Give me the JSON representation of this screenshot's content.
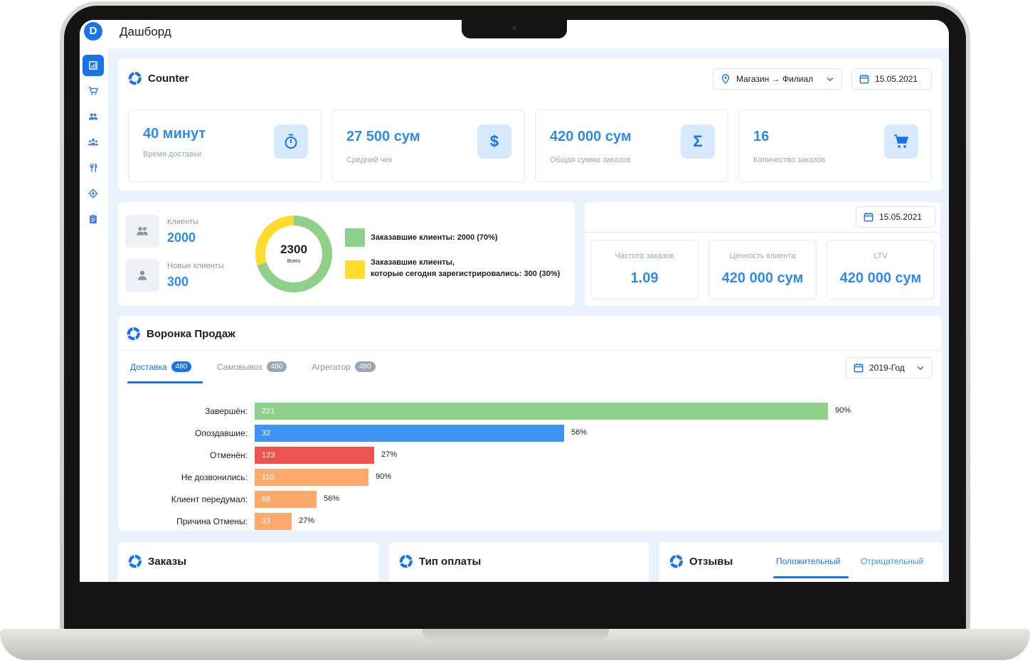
{
  "app": {
    "logo_letter": "D",
    "page_title": "Дашборд"
  },
  "sidebar": {
    "items": [
      {
        "icon": "chart-icon",
        "active": true
      },
      {
        "icon": "cart-icon",
        "active": false
      },
      {
        "icon": "users-icon",
        "active": false
      },
      {
        "icon": "group-icon",
        "active": false
      },
      {
        "icon": "restaurant-icon",
        "active": false
      },
      {
        "icon": "location-target-icon",
        "active": false
      },
      {
        "icon": "clipboard-icon",
        "active": false
      }
    ]
  },
  "counter": {
    "title": "Counter",
    "location_filter": "Магазин → Филиал",
    "date": "15.05.2021",
    "stats": [
      {
        "value": "40 минут",
        "label": "Время доставки",
        "icon": "stopwatch-icon"
      },
      {
        "value": "27 500 сум",
        "label": "Средний чек",
        "icon": "dollar-icon"
      },
      {
        "value": "420 000 сум",
        "label": "Общая сумма заказов",
        "icon": "sigma-icon"
      },
      {
        "value": "16",
        "label": "Количество заказов",
        "icon": "cart-icon"
      }
    ]
  },
  "clients": {
    "clients_label": "Клиенты",
    "clients_value": "2000",
    "new_clients_label": "Новые клиенты",
    "new_clients_value": "300",
    "donut_total": "2300",
    "donut_caption": "Всего",
    "legend": [
      {
        "text": "Заказавшие клиенты: 2000 (70%)",
        "color": "#8fd18b"
      },
      {
        "text_line1": "Заказавшие клиенты,",
        "text_line2": "которые сегодня зарегистрировались: 300 (30%)",
        "color": "#ffdb2e"
      }
    ],
    "chart_data": {
      "type": "pie",
      "labels": [
        "Заказавшие клиенты",
        "Заказавшие клиенты, которые сегодня зарегистрировались"
      ],
      "values": [
        70,
        30
      ],
      "colors": [
        "#8fd18b",
        "#ffdb2e"
      ]
    }
  },
  "metrics": {
    "date": "15.05.2021",
    "items": [
      {
        "label": "Частота заказов",
        "value": "1.09"
      },
      {
        "label": "Ценность клиента",
        "value": "420 000 сум"
      },
      {
        "label": "LTV",
        "value": "420 000 сум"
      }
    ]
  },
  "funnel": {
    "title": "Воронка Продаж",
    "tabs": [
      {
        "label": "Доставка",
        "count": "480",
        "active": true
      },
      {
        "label": "Самовывоз",
        "count": "480",
        "active": false
      },
      {
        "label": "Агрегатор",
        "count": "480",
        "active": false
      }
    ],
    "period": "2019-Год",
    "chart_data": {
      "type": "bar",
      "orientation": "horizontal",
      "categories": [
        "Завершён:",
        "Опоздавшие:",
        "Отменён:",
        "Не дозвонились:",
        "Клиент передумал:",
        "Причина Отмены:"
      ],
      "values": [
        221,
        32,
        123,
        110,
        68,
        33
      ],
      "percent_labels": [
        "90%",
        "56%",
        "27%",
        "90%",
        "56%",
        "27%"
      ],
      "bar_fraction": [
        1.0,
        0.54,
        0.208,
        0.199,
        0.108,
        0.065
      ],
      "colors": [
        "#8fd18b",
        "#3d94f2",
        "#ef5350",
        "#fca96b",
        "#fca96b",
        "#fca96b"
      ]
    }
  },
  "bottom_cards": {
    "orders_title": "Заказы",
    "payment_title": "Тип оплаты",
    "reviews_title": "Отзывы",
    "reviews_tabs": [
      "Положительный",
      "Отрицательный"
    ]
  }
}
